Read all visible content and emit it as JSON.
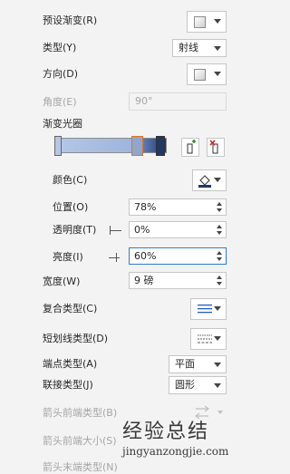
{
  "rows": {
    "preset_gradient": "预设渐变(R)",
    "type": "类型(Y)",
    "direction": "方向(D)",
    "angle": "角度(E)",
    "gradient_stops": "渐变光圈",
    "color": "颜色(C)",
    "position": "位置(O)",
    "transparency": "透明度(T)",
    "brightness": "亮度(I)",
    "width": "宽度(W)",
    "compound_type": "复合类型(C)",
    "dash_type": "短划线类型(D)",
    "cap_type": "端点类型(A)",
    "join_type": "联接类型(J)",
    "arrow_begin_type": "箭头前端类型(B)",
    "arrow_begin_size": "箭头前端大小(S)",
    "arrow_end_type": "箭头末端类型(N)"
  },
  "values": {
    "type": "射线",
    "angle": "90°",
    "position": "78%",
    "transparency": "0%",
    "brightness": "60%",
    "width": "9 磅",
    "cap": "平面",
    "join": "圆形"
  },
  "gradient": {
    "stop_positions_pct": [
      0,
      78,
      100
    ],
    "colors": {
      "light": "#b4c7e7",
      "mid": "#5b79b8",
      "dark": "#1f3864"
    }
  },
  "watermark": {
    "line1": "经验总结",
    "line2": "jingyanzongjie.com"
  },
  "icons": {
    "add_stop": "add-gradient-stop-icon",
    "remove_stop": "remove-gradient-stop-icon",
    "fill_color": "paint-bucket-icon",
    "compound": "compound-lines-icon",
    "dash": "dash-lines-icon",
    "arrow": "arrow-type-icon"
  }
}
